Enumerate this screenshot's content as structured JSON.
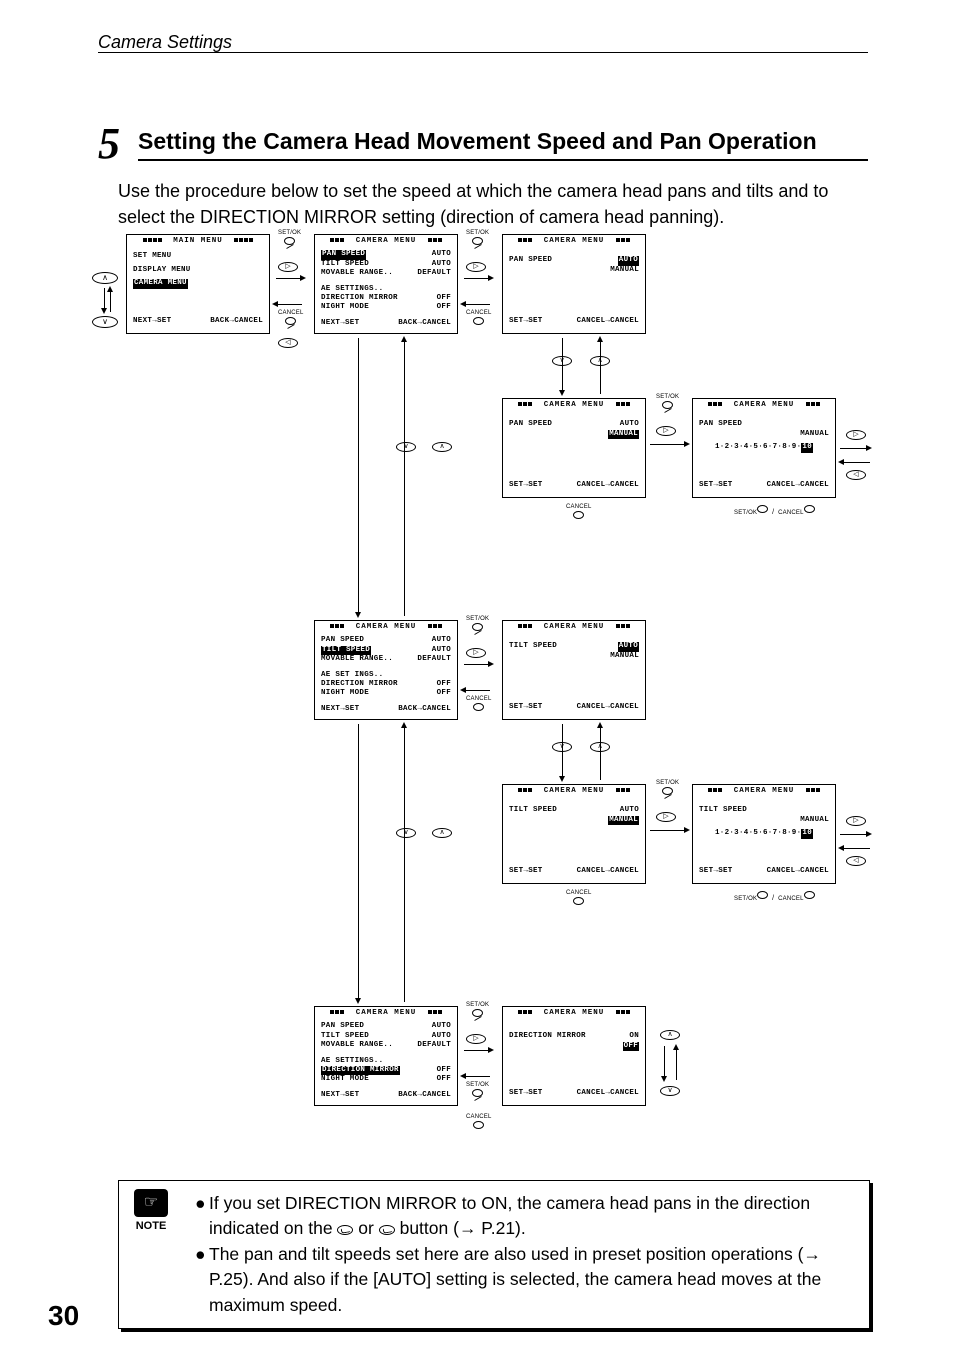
{
  "header": "Camera Settings",
  "step": "5",
  "title": "Setting the Camera Head Movement Speed and Pan Operation",
  "intro": "Use the procedure below to set the speed at which the camera head pans and tilts and to select the DIRECTION MIRROR setting (direction of camera head panning).",
  "page": "30",
  "btn": {
    "setok": "SET/OK",
    "cancel": "CANCEL"
  },
  "osd": {
    "main": {
      "title": "MAIN MENU",
      "items": [
        "SET MENU",
        "DISPLAY MENU",
        "CAMERA MENU"
      ],
      "footer_l": "NEXT→SET",
      "footer_r": "BACK→CANCEL"
    },
    "cam_menu_title": "CAMERA MENU",
    "pan": {
      "r1_l": "PAN SPEED",
      "r1_r": "AUTO",
      "r2_l": "TILT SPEED",
      "r2_r": "AUTO",
      "r3_l": "MOVABLE RANGE..",
      "r3_r": "DEFAULT",
      "r4_l": "AE SETTINGS..",
      "r4_r": "",
      "r5_l": "DIRECTION MIRROR",
      "r5_r": "OFF",
      "r6_l": "NIGHT MODE",
      "r6_r": "OFF"
    },
    "footer_next_l": "NEXT→SET",
    "footer_next_r": "BACK→CANCEL",
    "footer_set_l": "SET→SET",
    "footer_set_r": "CANCEL→CANCEL",
    "pan_speed_label": "PAN SPEED",
    "tilt_speed_label": "TILT SPEED",
    "dir_mirror_label": "DIRECTION MIRROR",
    "auto": "AUTO",
    "manual": "MANUAL",
    "on": "ON",
    "off": "OFF",
    "scale": "1·2·3·4·5·6·7·8·9·",
    "scale_sel": "10"
  },
  "note": {
    "label": "NOTE",
    "b1a": "If you set DIRECTION MIRROR to ON, the camera head pans in the direction indicated on the ",
    "b1b": " or ",
    "b1c": " button (→ P.21).",
    "b2": "The pan and tilt speeds set here are also used in preset position operations (→ P.25). And also if the [AUTO] setting is selected, the camera head moves at the maximum speed."
  }
}
